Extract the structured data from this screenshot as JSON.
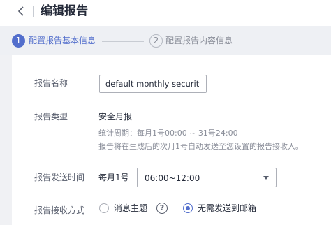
{
  "header": {
    "title": "编辑报告",
    "back_icon": "chevron-left-icon"
  },
  "steps": [
    {
      "number": "1",
      "label": "配置报告基本信息",
      "active": true
    },
    {
      "number": "2",
      "label": "配置报告内容信息",
      "active": false
    }
  ],
  "form": {
    "name": {
      "label": "报告名称",
      "value": "default monthly security r"
    },
    "type": {
      "label": "报告类型",
      "value": "安全月报",
      "period_hint": "统计周期：每月1号00:00 ~ 31号24:00",
      "send_hint": "报告将在生成后的次月1号自动发送至您设置的报告接收人。"
    },
    "send_time": {
      "label": "报告发送时间",
      "prefix": "每月1号",
      "selected": "06:00~12:00"
    },
    "receive_method": {
      "label": "报告接收方式",
      "options": [
        {
          "label": "消息主题",
          "checked": false
        },
        {
          "label": "无需发送到邮箱",
          "checked": true
        }
      ],
      "help_icon": "question-circle-icon"
    }
  },
  "colors": {
    "accent": "#526ecc",
    "background": "#f0f1f4"
  }
}
